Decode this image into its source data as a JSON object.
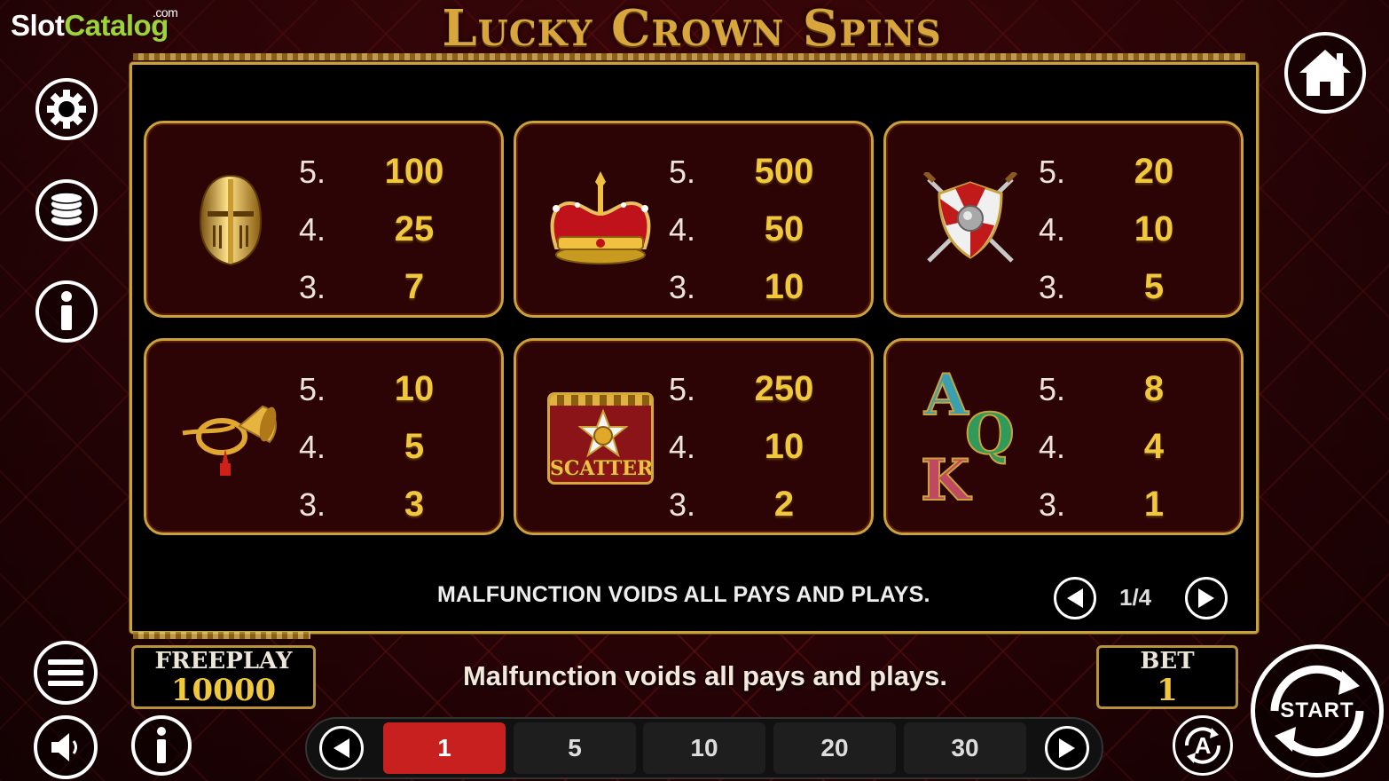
{
  "branding": {
    "site_name_part1": "Slot",
    "site_name_part2": "Catalog",
    "site_suffix": ".com",
    "game_title": "Lucky Crown Spins"
  },
  "paytable": [
    {
      "symbol": "golden-helmet-icon",
      "pays": [
        {
          "count": "5.",
          "value": "100"
        },
        {
          "count": "4.",
          "value": "25"
        },
        {
          "count": "3.",
          "value": "7"
        }
      ]
    },
    {
      "symbol": "crown-icon",
      "pays": [
        {
          "count": "5.",
          "value": "500"
        },
        {
          "count": "4.",
          "value": "50"
        },
        {
          "count": "3.",
          "value": "10"
        }
      ]
    },
    {
      "symbol": "shield-swords-icon",
      "pays": [
        {
          "count": "5.",
          "value": "20"
        },
        {
          "count": "4.",
          "value": "10"
        },
        {
          "count": "3.",
          "value": "5"
        }
      ]
    },
    {
      "symbol": "horn-icon",
      "pays": [
        {
          "count": "5.",
          "value": "10"
        },
        {
          "count": "4.",
          "value": "5"
        },
        {
          "count": "3.",
          "value": "3"
        }
      ]
    },
    {
      "symbol": "scatter-icon",
      "symbol_label": "SCATTER",
      "pays": [
        {
          "count": "5.",
          "value": "250"
        },
        {
          "count": "4.",
          "value": "10"
        },
        {
          "count": "3.",
          "value": "2"
        }
      ]
    },
    {
      "symbol": "aqk-letters-icon",
      "letters": [
        "A",
        "Q",
        "K"
      ],
      "pays": [
        {
          "count": "5.",
          "value": "8"
        },
        {
          "count": "4.",
          "value": "4"
        },
        {
          "count": "3.",
          "value": "1"
        }
      ]
    }
  ],
  "panel": {
    "disclaimer": "MALFUNCTION VOIDS ALL PAYS AND PLAYS.",
    "page": "1/4"
  },
  "status": {
    "freeplay_label": "FREEPLAY",
    "freeplay_value": "10000",
    "message": "Malfunction voids all pays and plays.",
    "bet_label": "BET",
    "bet_value": "1"
  },
  "bet_options": [
    "1",
    "5",
    "10",
    "20",
    "30"
  ],
  "selected_bet": "1",
  "controls": {
    "start_label": "START",
    "auto_label": "A"
  },
  "colors": {
    "gold": "#c9a23b",
    "value_gold": "#f1c83c",
    "active_bet": "#c8201e",
    "background": "#3a0508"
  }
}
